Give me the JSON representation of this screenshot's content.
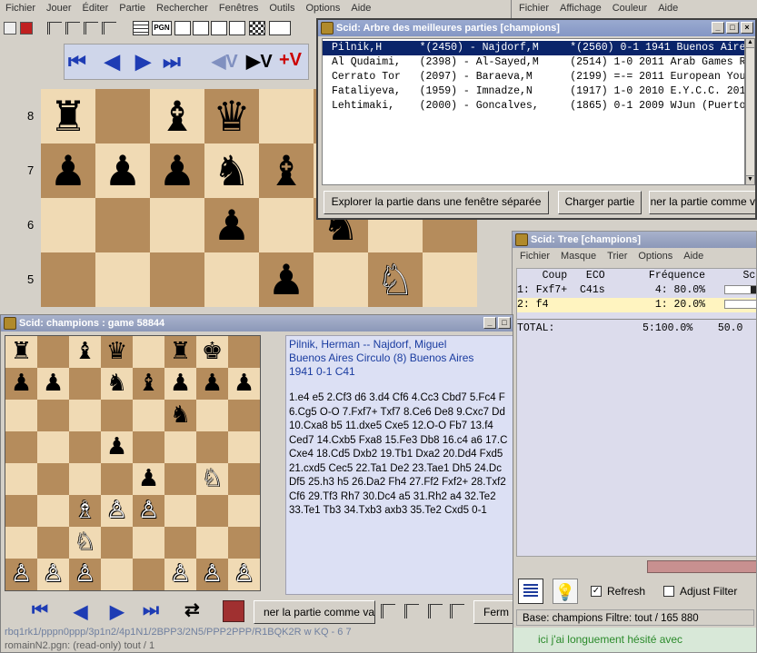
{
  "main": {
    "menu": [
      "Fichier",
      "Jouer",
      "Éditer",
      "Partie",
      "Rechercher",
      "Fenêtres",
      "Outils",
      "Options",
      "Aide"
    ],
    "rank_labels": [
      "8",
      "7",
      "6",
      "5"
    ],
    "board_rows": [
      [
        "",
        "",
        "",
        "",
        "",
        "",
        "",
        ""
      ],
      [
        "",
        "",
        "",
        "",
        "",
        "",
        "",
        ""
      ],
      [
        "",
        "",
        "",
        "",
        "",
        "",
        "",
        ""
      ],
      [
        "",
        "",
        "",
        "",
        "",
        "",
        "",
        ""
      ]
    ],
    "board_pieces": [
      [
        "♜",
        "",
        "♝",
        "♛",
        "",
        "",
        "",
        ""
      ],
      [
        "♟",
        "♟",
        "♟",
        "♞",
        "♝",
        "",
        "",
        ""
      ],
      [
        "",
        "",
        "",
        "♟",
        "",
        "♞",
        "",
        ""
      ],
      [
        "",
        "",
        "",
        "",
        "♟",
        "",
        "♘",
        ""
      ]
    ],
    "toolbar_icon_pgn": "PGN"
  },
  "best_games": {
    "title": "Scid: Arbre des meilleures parties [champions]",
    "rows": [
      "Pilnik,H      *(2450) - Najdorf,M     *(2560) 0-1 1941 Buenos Aires C",
      "Al Qudaimi,   (2398) - Al-Sayed,M     (2514) 1-0 2011 Arab Games Raj",
      "Cerrato Tor   (2097) - Baraeva,M      (2199) =-= 2011 European Youth",
      "Fataliyeva,   (1959) - Imnadze,N      (1917) 1-0 2010 E.Y.C.C. 2010",
      "Lehtimaki,    (2000) - Goncalves,     (1865) 0-1 2009 WJun (Puerto R"
    ],
    "btn_explore": "Explorer la partie dans une fenêtre séparée",
    "btn_load": "Charger partie",
    "btn_merge": "ner la partie comme v"
  },
  "right_menu": [
    "Fichier",
    "Affichage",
    "Couleur",
    "Aide"
  ],
  "tree": {
    "title": "Scid: Tree [champions]",
    "menu": [
      "Fichier",
      "Masque",
      "Trier",
      "Options",
      "Aide"
    ],
    "header": "    Coup   ECO       Fréquence      Sc",
    "rows": [
      "1: Fxf7+  C41s        4: 80.0%",
      "2: f4                 1: 20.0%"
    ],
    "total": "TOTAL:              5:100.0%    50.0",
    "refresh_label": "Refresh",
    "adjust_label": "Adjust Filter",
    "status": "Base: champions  Filtre: tout / 165 880",
    "green_text": "ici j'ai longuement hésité avec"
  },
  "game": {
    "title": "Scid:  champions :  game 58844",
    "header_line1": "Pilnik, Herman  --  Najdorf, Miguel",
    "header_line2": "Buenos Aires Circulo (8)  Buenos Aires",
    "header_line3": "1941  0-1  C41",
    "moves": [
      "1.e4 e5 2.Cf3 d6 3.d4 Cf6 4.Cc3 Cbd7 5.Fc4 F",
      "6.Cg5 O-O 7.Fxf7+ Txf7 8.Ce6 De8 9.Cxc7 Dd",
      "10.Cxa8 b5 11.dxe5 Cxe5 12.O-O Fb7 13.f4",
      "Ced7 14.Cxb5 Fxa8 15.Fe3 Db8 16.c4 a6 17.C",
      "Cxe4 18.Cd5 Dxb2 19.Tb1 Dxa2 20.Dd4 Fxd5",
      "21.cxd5 Cec5 22.Ta1 De2 23.Tae1 Dh5 24.Dc",
      "Df5 25.h3 h5 26.Da2 Fh4 27.Ff2 Fxf2+ 28.Txf2",
      "Cf6 29.Tf3 Rh7 30.Dc4 a5 31.Rh2 a4 32.Te2 ",
      "33.Te1 Tb3 34.Txb3 axb3 35.Te2 Cxd5 0-1"
    ],
    "board_pieces": [
      [
        "♜",
        "",
        "♝",
        "♛",
        "",
        "♜",
        "♚",
        ""
      ],
      [
        "♟",
        "♟",
        "",
        "♞",
        "♝",
        "♟",
        "♟",
        "♟"
      ],
      [
        "",
        "",
        "",
        "",
        "",
        "♞",
        "",
        ""
      ],
      [
        "",
        "",
        "",
        "♟",
        "",
        "",
        "",
        ""
      ],
      [
        "",
        "",
        "",
        "",
        "♟",
        "",
        "♘",
        ""
      ],
      [
        "",
        "",
        "♗",
        "♙",
        "♙",
        "",
        "",
        ""
      ],
      [
        "",
        "",
        "♘",
        "",
        "",
        "",
        "",
        ""
      ],
      [
        "♙",
        "♙",
        "♙",
        "",
        "",
        "♙",
        "♙",
        "♙"
      ],
      [
        "♖",
        "",
        "♗",
        "♕",
        "♔",
        "",
        "♖",
        ""
      ]
    ],
    "btn_merge": "ner la partie comme va",
    "btn_close": "Ferm",
    "fen": "rbq1rk1/pppn0ppp/3p1n2/4p1N1/2BPP3/2N5/PPP2PPP/R1BQK2R w KQ - 6 7",
    "status2": "romainN2.pgn: (read-only)  tout / 1"
  },
  "colors": {
    "title_bar_inactive": "#9aaad0",
    "selection": "#0a246a",
    "light_square": "#f0dab4",
    "dark_square": "#b58c5c",
    "moves_bg": "#dce0f4",
    "tree_highlight": "#fff4c0",
    "pink_bar": "#c89090"
  }
}
